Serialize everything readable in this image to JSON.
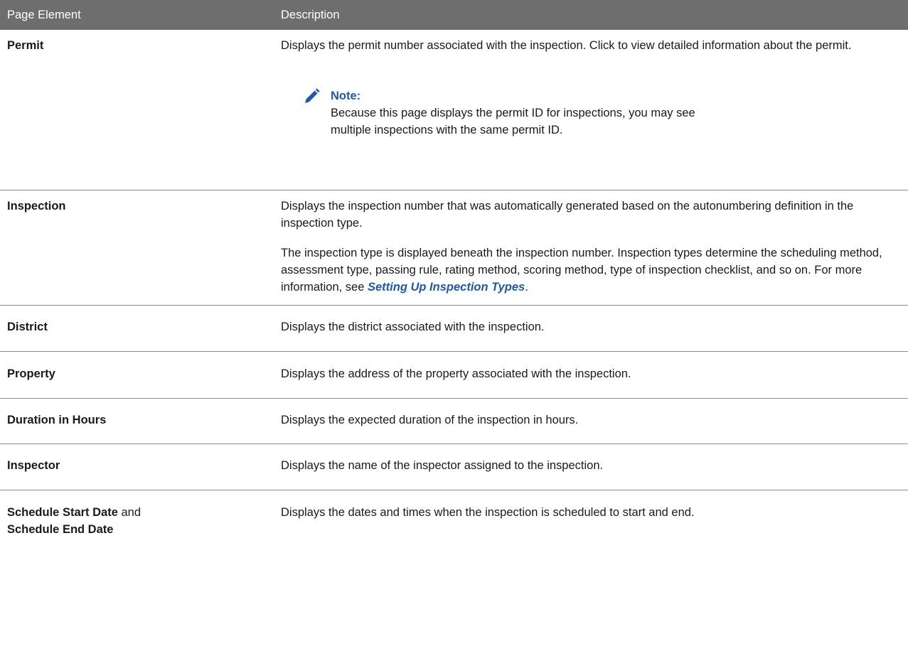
{
  "header": {
    "col1": "Page Element",
    "col2": "Description"
  },
  "rows": {
    "permit": {
      "element": "Permit",
      "description": "Displays the permit number associated with the inspection. Click to view detailed information about the permit.",
      "note_title": "Note:",
      "note_text": "Because this page displays the permit ID for inspections, you may see multiple inspections with the same permit ID.",
      "note_icon": "pencil-icon"
    },
    "inspection": {
      "element": "Inspection",
      "description_1": "Displays the inspection number that was automatically generated based on the autonumbering definition in the inspection type.",
      "description_2_before": "The inspection type is displayed beneath the inspection number. Inspection types determine the scheduling method, assessment type, passing rule, rating method, scoring method, type of inspection checklist, and so on. For more information, see ",
      "link_text": "Setting Up Inspection Types",
      "description_2_after": "."
    },
    "district": {
      "element": "District",
      "description": "Displays the district associated with the inspection."
    },
    "property": {
      "element": "Property",
      "description": "Displays the address of the property associated with the inspection."
    },
    "duration": {
      "element": "Duration in Hours",
      "description": "Displays the expected duration of the inspection in hours."
    },
    "inspector": {
      "element": "Inspector",
      "description": "Displays the name of the inspector assigned to the inspection."
    },
    "schedule": {
      "element_part1": "Schedule Start Date",
      "element_conj": " and",
      "element_part2": "Schedule End Date",
      "description": "Displays the dates and times when the inspection is scheduled to start and end."
    }
  },
  "colors": {
    "header_bg": "#6e6e6e",
    "link": "#1f5aa8",
    "note_accent": "#1f5aa8"
  }
}
